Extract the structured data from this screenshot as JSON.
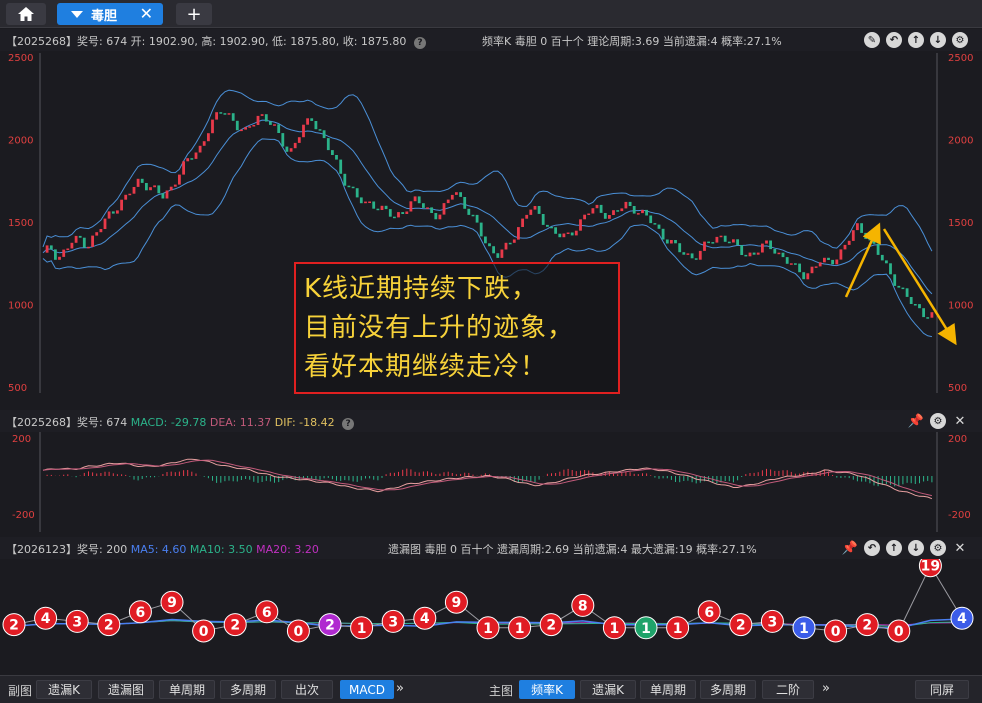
{
  "tabs": {
    "active_label": "毒胆",
    "close": "✕",
    "add": "+"
  },
  "kline_header": {
    "info": "【2025268】奖号: 674  开: 1902.90, 高: 1902.90, 低: 1875.80, 收: 1875.80",
    "help": "?",
    "right": "频率K   毒胆   0   百十个   理论周期:3.69   当前遗漏:4   概率:27.1%"
  },
  "macd_header": {
    "prefix": "【2025268】奖号: 674",
    "macd": "MACD: -29.78",
    "dea": "DEA: 11.37",
    "dif": "DIF: -18.42",
    "help": "?"
  },
  "miss_header": {
    "prefix": "【2026123】奖号: 200",
    "ma5": "MA5: 4.60",
    "ma10": "MA10: 3.50",
    "ma20": "MA20: 3.20",
    "right": "遗漏图   毒胆   0   百十个   遗漏周期:2.69   当前遗漏:4   最大遗漏:19   概率:27.1%"
  },
  "callout": [
    "K线近期持续下跌，",
    "目前没有上升的迹象，",
    "看好本期继续走冷！"
  ],
  "bottombar": {
    "left_label": "副图",
    "left_buttons": [
      "遗漏K",
      "遗漏图",
      "单周期",
      "多周期",
      "出次",
      "MACD"
    ],
    "left_active": 5,
    "more": "»",
    "right_label": "主图",
    "right_buttons": [
      "频率K",
      "遗漏K",
      "单周期",
      "多周期",
      "二阶"
    ],
    "right_active": 0,
    "fullscreen": "同屏"
  },
  "colors": {
    "up": "#e83a4a",
    "down": "#2bb38a",
    "band": "#4a8fd6",
    "accent": "#1f7fe0",
    "callout_text": "#f7d23a",
    "callout_border": "#e02020",
    "arrow": "#f5b400"
  },
  "chart_data": [
    {
      "type": "candlestick",
      "title": "频率K",
      "ylim": [
        500,
        2500
      ],
      "yticks": [
        2500,
        2000,
        1500,
        1000,
        500
      ],
      "close_path": [
        1300,
        1350,
        1280,
        1330,
        1380,
        1400,
        1360,
        1420,
        1480,
        1560,
        1600,
        1640,
        1700,
        1760,
        1720,
        1690,
        1650,
        1700,
        1780,
        1850,
        1900,
        1950,
        2050,
        2120,
        2180,
        2150,
        2080,
        2030,
        2100,
        2160,
        2120,
        2060,
        1990,
        1920,
        2000,
        2080,
        2130,
        2060,
        1960,
        1880,
        1780,
        1720,
        1650,
        1600,
        1620,
        1590,
        1560,
        1520,
        1560,
        1610,
        1630,
        1590,
        1560,
        1540,
        1600,
        1700,
        1640,
        1560,
        1480,
        1400,
        1330,
        1300,
        1340,
        1410,
        1500,
        1580,
        1560,
        1510,
        1460,
        1420,
        1400,
        1450,
        1510,
        1560,
        1580,
        1560,
        1540,
        1570,
        1600,
        1590,
        1560,
        1520,
        1470,
        1420,
        1380,
        1330,
        1300,
        1290,
        1320,
        1370,
        1400,
        1420,
        1380,
        1340,
        1300,
        1310,
        1340,
        1360,
        1330,
        1290,
        1250,
        1200,
        1180,
        1220,
        1260,
        1250,
        1280,
        1330,
        1400,
        1470,
        1440,
        1370,
        1290,
        1220,
        1150,
        1080,
        1020,
        980,
        950,
        930
      ],
      "bands": "bollinger upper/mid/lower"
    },
    {
      "type": "bar",
      "title": "MACD",
      "ylim": [
        -200,
        200
      ],
      "yticks": [
        200,
        -200
      ],
      "dif_path": [
        30,
        40,
        35,
        50,
        60,
        70,
        55,
        50,
        60,
        80,
        90,
        70,
        50,
        40,
        20,
        0,
        -10,
        -20,
        -30,
        -40,
        -60,
        -70,
        -80,
        -60,
        -40,
        -30,
        -20,
        -10,
        -5,
        0,
        -10,
        -30,
        -50,
        -40,
        -20,
        0,
        10,
        20,
        30,
        40,
        35,
        20,
        0,
        -20,
        -40,
        -60,
        -50,
        -30,
        -10,
        0,
        10,
        30,
        20,
        10,
        -20,
        -50,
        -80,
        -100,
        -120
      ]
    },
    {
      "type": "line",
      "title": "遗漏图",
      "values": [
        2,
        4,
        3,
        2,
        6,
        9,
        0,
        2,
        6,
        0,
        2,
        1,
        3,
        4,
        9,
        1,
        1,
        2,
        8,
        1,
        1,
        1,
        6,
        2,
        3,
        1,
        0,
        2,
        0,
        19,
        4
      ],
      "colors": [
        "r",
        "r",
        "r",
        "r",
        "r",
        "r",
        "r",
        "r",
        "r",
        "r",
        "p",
        "r",
        "r",
        "r",
        "r",
        "r",
        "r",
        "r",
        "r",
        "r",
        "g",
        "r",
        "r",
        "r",
        "r",
        "b",
        "r",
        "r",
        "r",
        "r",
        "b"
      ]
    }
  ]
}
